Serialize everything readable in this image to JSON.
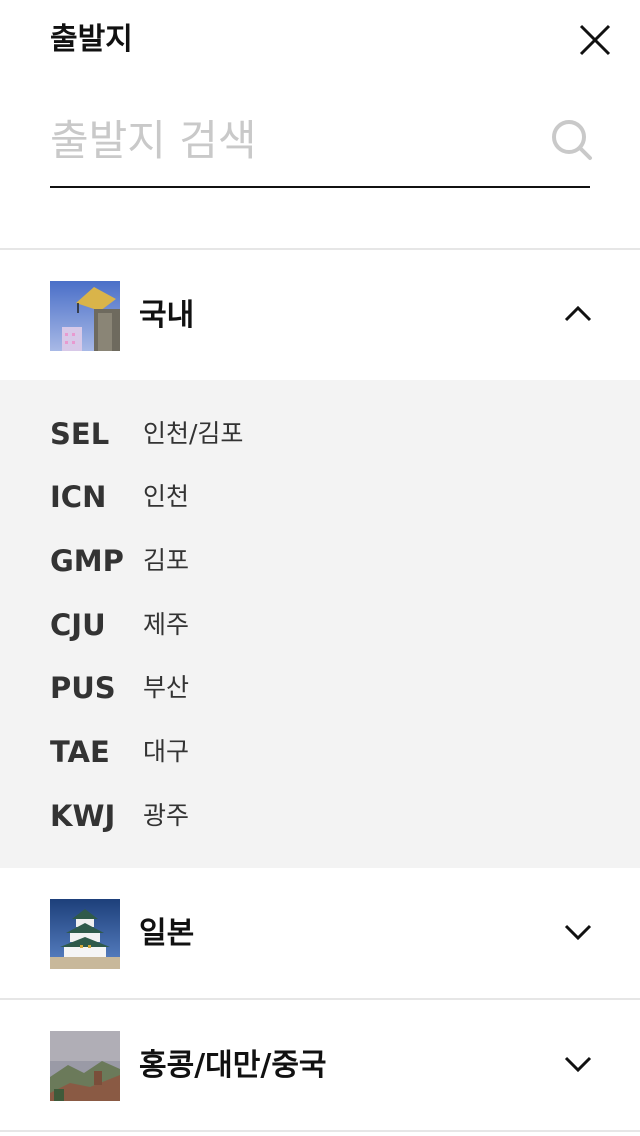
{
  "header": {
    "title": "출발지"
  },
  "search": {
    "placeholder": "출발지 검색"
  },
  "regions": [
    {
      "name": "국내",
      "expanded": true,
      "airports": [
        {
          "code": "SEL",
          "city": "인천/김포"
        },
        {
          "code": "ICN",
          "city": "인천"
        },
        {
          "code": "GMP",
          "city": "김포"
        },
        {
          "code": "CJU",
          "city": "제주"
        },
        {
          "code": "PUS",
          "city": "부산"
        },
        {
          "code": "TAE",
          "city": "대구"
        },
        {
          "code": "KWJ",
          "city": "광주"
        }
      ]
    },
    {
      "name": "일본",
      "expanded": false
    },
    {
      "name": "홍콩/대만/중국",
      "expanded": false
    }
  ]
}
